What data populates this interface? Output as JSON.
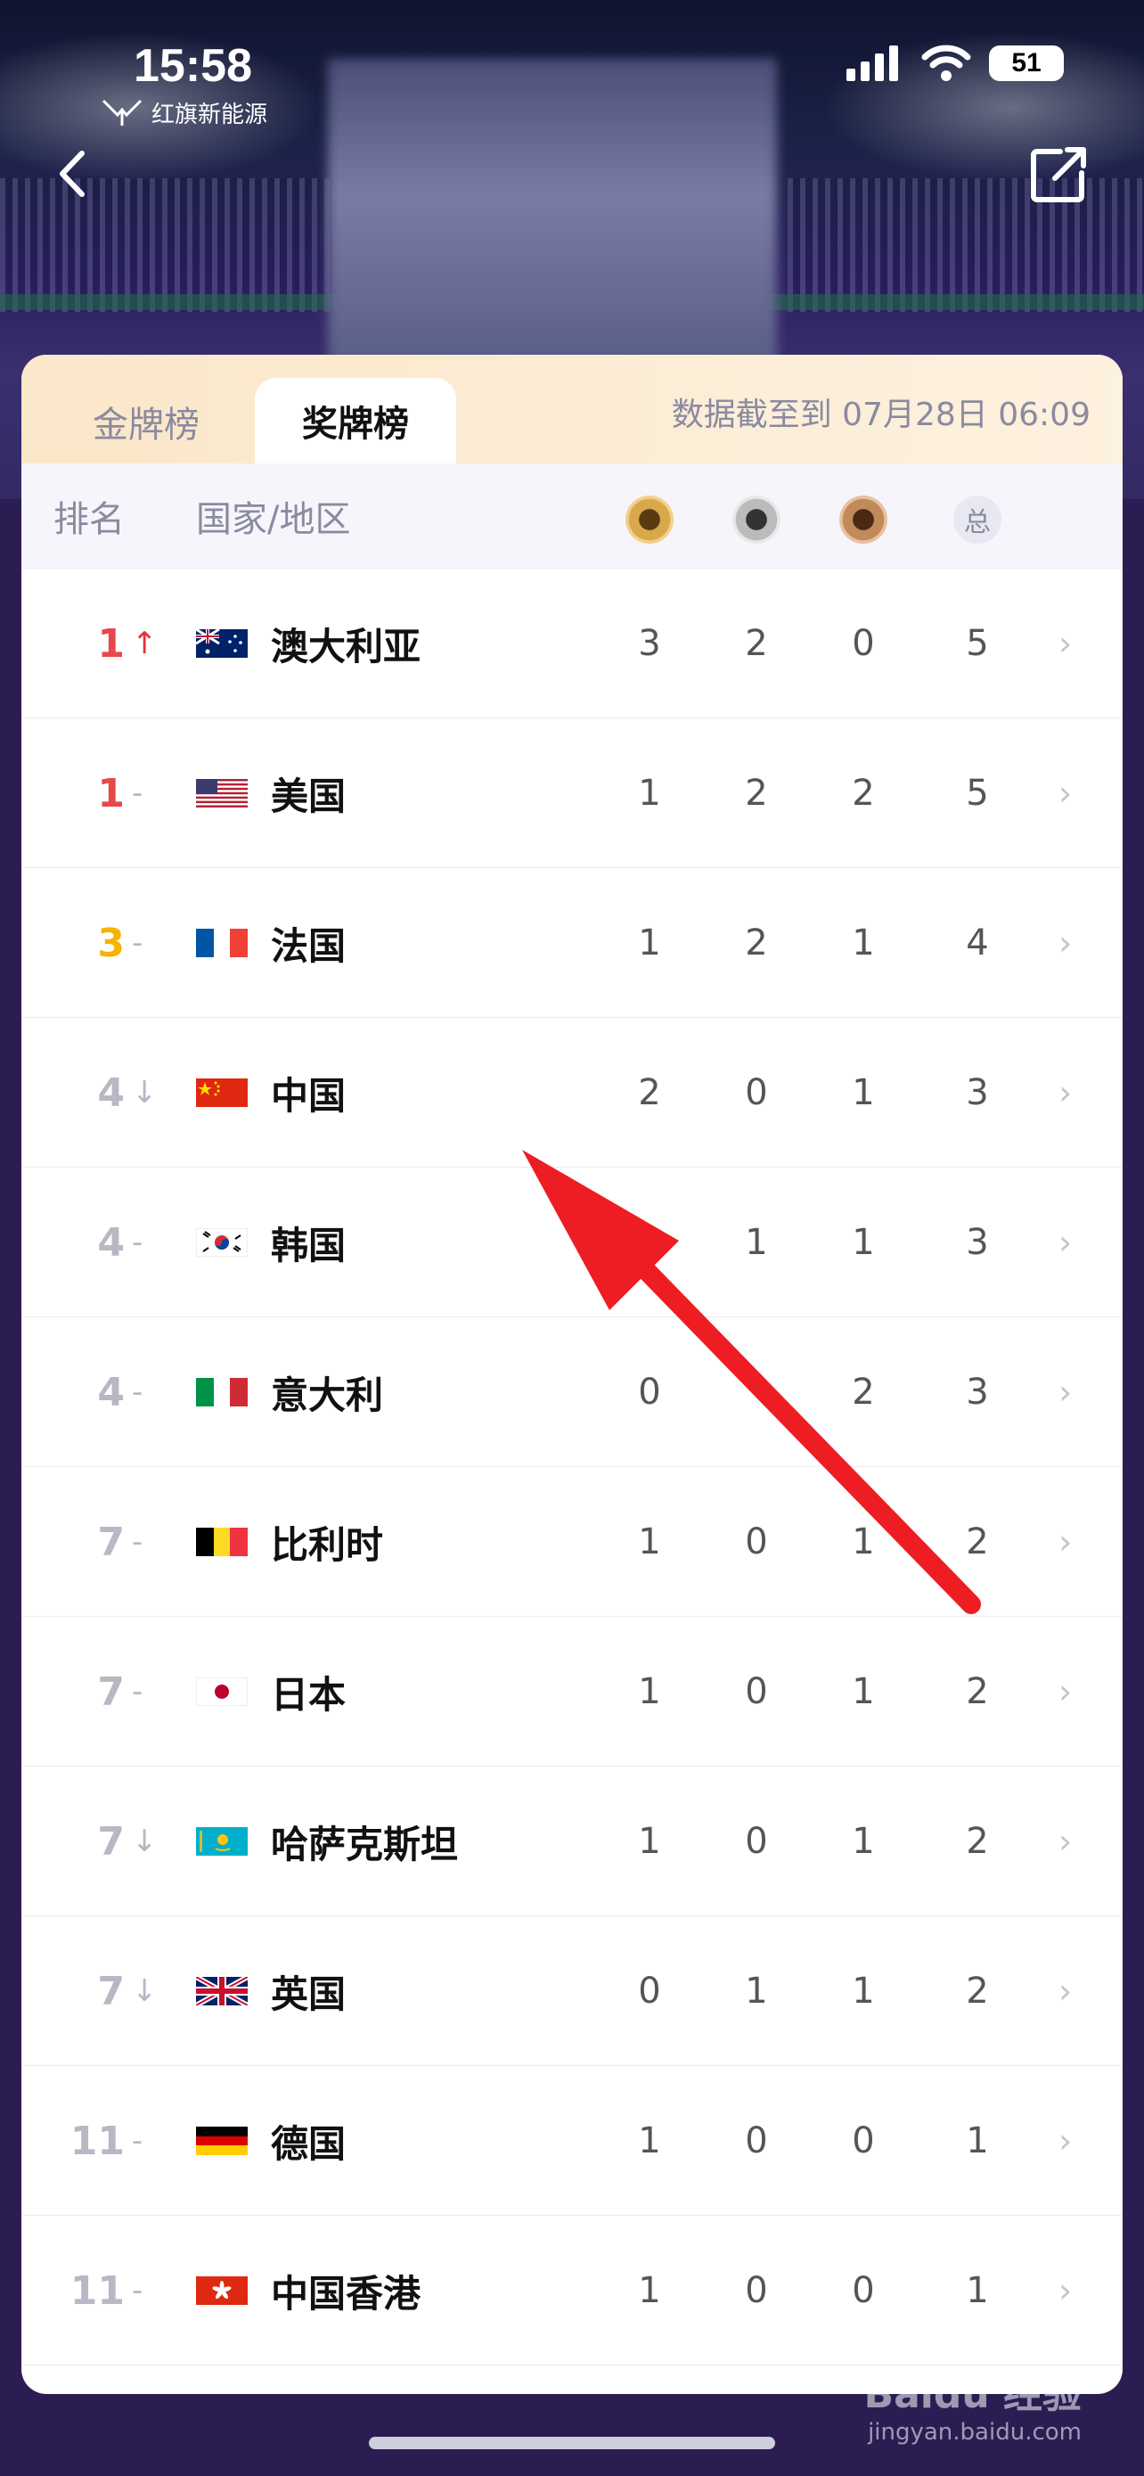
{
  "status_bar": {
    "time": "15:58",
    "battery": "51"
  },
  "brand": {
    "logo_text": "红旗新能源"
  },
  "colors": {
    "rank_red": "#e8474c",
    "rank_yellow": "#f4b400",
    "rank_gray": "#b8b8c4",
    "trend_up": "#e8303a",
    "arrow": "#ee1d23"
  },
  "tabs": [
    {
      "label": "金牌榜",
      "active": false
    },
    {
      "label": "奖牌榜",
      "active": true
    }
  ],
  "updated": "数据截至到 07月28日 06:09",
  "table_header": {
    "rank": "排名",
    "country": "国家/地区",
    "total": "总"
  },
  "rows": [
    {
      "rank": "1",
      "rank_color": "red",
      "trend": "↑",
      "trend_type": "up",
      "flag": "AU",
      "country": "澳大利亚",
      "gold": "3",
      "silver": "2",
      "bronze": "0",
      "total": "5"
    },
    {
      "rank": "1",
      "rank_color": "red",
      "trend": "-",
      "trend_type": "same",
      "flag": "US",
      "country": "美国",
      "gold": "1",
      "silver": "2",
      "bronze": "2",
      "total": "5"
    },
    {
      "rank": "3",
      "rank_color": "yellow",
      "trend": "-",
      "trend_type": "same",
      "flag": "FR",
      "country": "法国",
      "gold": "1",
      "silver": "2",
      "bronze": "1",
      "total": "4"
    },
    {
      "rank": "4",
      "rank_color": "gray",
      "trend": "↓",
      "trend_type": "down",
      "flag": "CN",
      "country": "中国",
      "gold": "2",
      "silver": "0",
      "bronze": "1",
      "total": "3"
    },
    {
      "rank": "4",
      "rank_color": "gray",
      "trend": "-",
      "trend_type": "same",
      "flag": "KR",
      "country": "韩国",
      "gold": "",
      "silver": "1",
      "bronze": "1",
      "total": "3"
    },
    {
      "rank": "4",
      "rank_color": "gray",
      "trend": "-",
      "trend_type": "same",
      "flag": "IT",
      "country": "意大利",
      "gold": "0",
      "silver": "",
      "bronze": "2",
      "total": "3"
    },
    {
      "rank": "7",
      "rank_color": "gray",
      "trend": "-",
      "trend_type": "same",
      "flag": "BE",
      "country": "比利时",
      "gold": "1",
      "silver": "0",
      "bronze": "1",
      "total": "2"
    },
    {
      "rank": "7",
      "rank_color": "gray",
      "trend": "-",
      "trend_type": "same",
      "flag": "JP",
      "country": "日本",
      "gold": "1",
      "silver": "0",
      "bronze": "1",
      "total": "2"
    },
    {
      "rank": "7",
      "rank_color": "gray",
      "trend": "↓",
      "trend_type": "down",
      "flag": "KZ",
      "country": "哈萨克斯坦",
      "gold": "1",
      "silver": "0",
      "bronze": "1",
      "total": "2"
    },
    {
      "rank": "7",
      "rank_color": "gray",
      "trend": "↓",
      "trend_type": "down",
      "flag": "GB",
      "country": "英国",
      "gold": "0",
      "silver": "1",
      "bronze": "1",
      "total": "2"
    },
    {
      "rank": "11",
      "rank_color": "gray",
      "trend": "-",
      "trend_type": "same",
      "flag": "DE",
      "country": "德国",
      "gold": "1",
      "silver": "0",
      "bronze": "0",
      "total": "1"
    },
    {
      "rank": "11",
      "rank_color": "gray",
      "trend": "-",
      "trend_type": "same",
      "flag": "HK",
      "country": "中国香港",
      "gold": "1",
      "silver": "0",
      "bronze": "0",
      "total": "1"
    }
  ],
  "watermark": {
    "title": "Baidu 经验",
    "subtitle": "jingyan.baidu.com"
  }
}
